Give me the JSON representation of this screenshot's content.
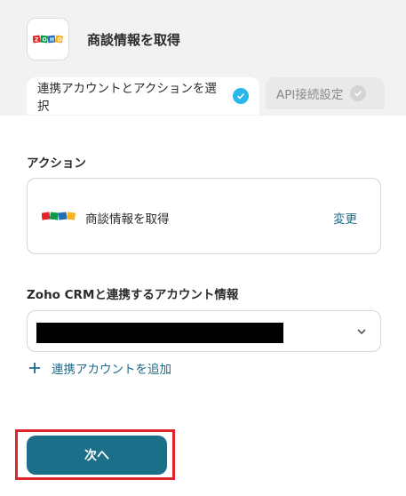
{
  "header": {
    "title": "商談情報を取得",
    "app_icon": "zoho-logo"
  },
  "tabs": [
    {
      "label": "連携アカウントとアクションを選択",
      "state": "active",
      "icon": "check-circle-icon"
    },
    {
      "label": "API接続設定",
      "state": "inactive",
      "icon": "check-circle-icon"
    }
  ],
  "action_section": {
    "label": "アクション",
    "action_name": "商談情報を取得",
    "change_label": "変更"
  },
  "account_section": {
    "label": "Zoho CRMと連携するアカウント情報",
    "add_label": "連携アカウントを追加"
  },
  "next_button": {
    "label": "次へ"
  },
  "colors": {
    "accent": "#1c6f89",
    "check_active": "#29b6e8",
    "highlight": "#e0242b"
  }
}
